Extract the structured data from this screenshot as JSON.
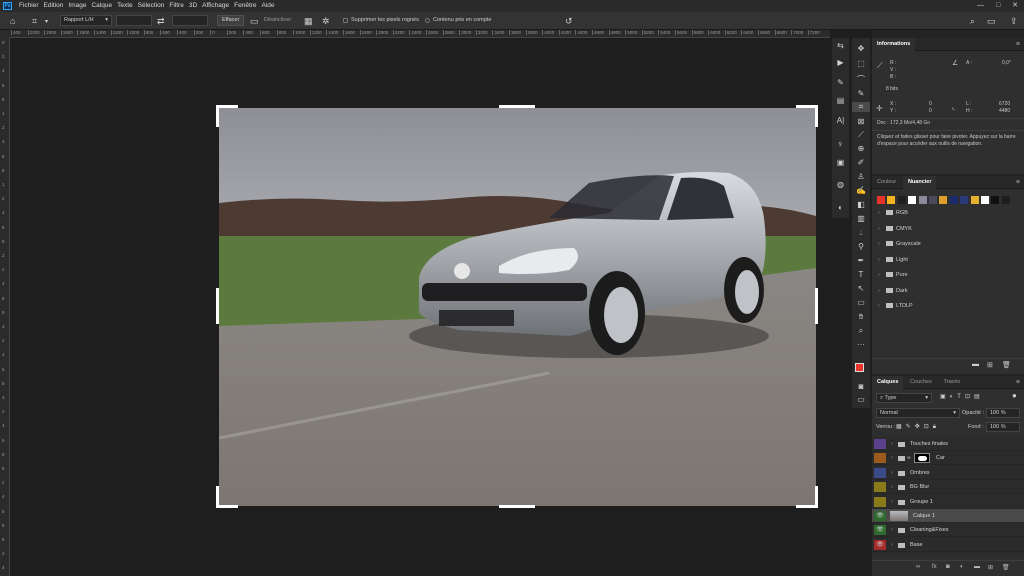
{
  "menubar": {
    "logo": "Ps",
    "items": [
      "Fichier",
      "Edition",
      "Image",
      "Calque",
      "Texte",
      "Sélection",
      "Filtre",
      "3D",
      "Affichage",
      "Fenêtre",
      "Aide"
    ],
    "window_controls": [
      "—",
      "□",
      "✕"
    ]
  },
  "options": {
    "ratio_label": "Rapport L/H",
    "clear_label": "Effacer",
    "straighten_label": "Désincliner",
    "delete_pixels_label": "Supprimer les pixels rognés",
    "content_aware_label": "Contenu pris en compte"
  },
  "ruler": {
    "top_ticks": [
      "400",
      "2200",
      "2000",
      "1800",
      "1600",
      "1400",
      "1200",
      "1000",
      "800",
      "600",
      "400",
      "200",
      "0",
      "200",
      "400",
      "600",
      "800",
      "1000",
      "1200",
      "1400",
      "1600",
      "1800",
      "2000",
      "2200",
      "2400",
      "2600",
      "2800",
      "3000",
      "3200",
      "3400",
      "3600",
      "3800",
      "4000",
      "4200",
      "4400",
      "4600",
      "4800",
      "5000",
      "5200",
      "5400",
      "5600",
      "5800",
      "6000",
      "6200",
      "6400",
      "6600",
      "6800",
      "7000",
      "7200"
    ],
    "left_ticks": [
      "0",
      "2",
      "4",
      "6",
      "8",
      "1",
      "2",
      "4",
      "6",
      "8",
      "1",
      "2",
      "4",
      "6",
      "8",
      "2",
      "2",
      "4",
      "6",
      "8",
      "3",
      "2",
      "4",
      "6",
      "8",
      "4",
      "2",
      "4",
      "6",
      "8",
      "5",
      "2",
      "4",
      "6",
      "8",
      "6",
      "2",
      "4"
    ]
  },
  "info_panel": {
    "tab": "Informations",
    "r_label": "R :",
    "v_label": "V :",
    "b_label": "B :",
    "bits": "8 bits",
    "a_label": "A :",
    "a_value": "0,0°",
    "x_label": "X :",
    "x_value": "0",
    "y_label": "Y :",
    "y_value": "0",
    "l_label": "L :",
    "l_value": "6720",
    "h_label": "H :",
    "h_value": "4480",
    "doc": "Doc : 172,3 Mo/4,48 Go",
    "hint": "Cliquez et faites glisser pour faire pivoter. Appuyez sur la barre d'espace pour accéder aux outils de navigation."
  },
  "swatches_panel": {
    "tabs": [
      "Couleur",
      "Nuancier"
    ],
    "colors": [
      "#e8342b",
      "#f5b324",
      "#1f1f1f",
      "#ffffff",
      "#8a8a9a",
      "#4a4a5c",
      "#e0a030",
      "#1a2a6c",
      "#2a3a7a",
      "#e8b030",
      "#ffffff",
      "#101010",
      "#1e1e1e"
    ],
    "folders": [
      "RGB",
      "CMYK",
      "Grayscale",
      "Light",
      "Pure",
      "Dark",
      "LTDLP"
    ]
  },
  "layers_panel": {
    "tabs": [
      "Calques",
      "Couches",
      "Tracés"
    ],
    "filter": "Type",
    "blend_mode": "Normal",
    "opacity_label": "Opacité :",
    "opacity_value": "100 %",
    "lock_label": "Verrou :",
    "fill_label": "Fond :",
    "fill_value": "100 %",
    "layers": [
      {
        "name": "Touches finales",
        "color": "#5b3f8a",
        "type": "folder",
        "visible": false
      },
      {
        "name": "Car",
        "color": "#9a5a1a",
        "type": "smart",
        "visible": false
      },
      {
        "name": "Ombres",
        "color": "#3a4a8a",
        "type": "folder",
        "visible": false
      },
      {
        "name": "BG Blur",
        "color": "#8a7a1a",
        "type": "folder",
        "visible": false
      },
      {
        "name": "Groupe 1",
        "color": "#8a7a1a",
        "type": "folder",
        "visible": false
      },
      {
        "name": "Calque 1",
        "color": "#2f6a2f",
        "type": "image",
        "visible": true
      },
      {
        "name": "Cleaning&Fixes",
        "color": "#2f6a2f",
        "type": "folder",
        "visible": true
      },
      {
        "name": "Base",
        "color": "#a52a2a",
        "type": "folder",
        "visible": true
      }
    ]
  },
  "icons": {
    "home": "home-icon",
    "crop": "crop-icon",
    "swap": "swap-icon",
    "grid": "grid-icon",
    "gear": "gear-icon",
    "undo": "undo-icon",
    "search": "search-icon",
    "workspace": "workspace-icon",
    "share": "share-icon"
  }
}
